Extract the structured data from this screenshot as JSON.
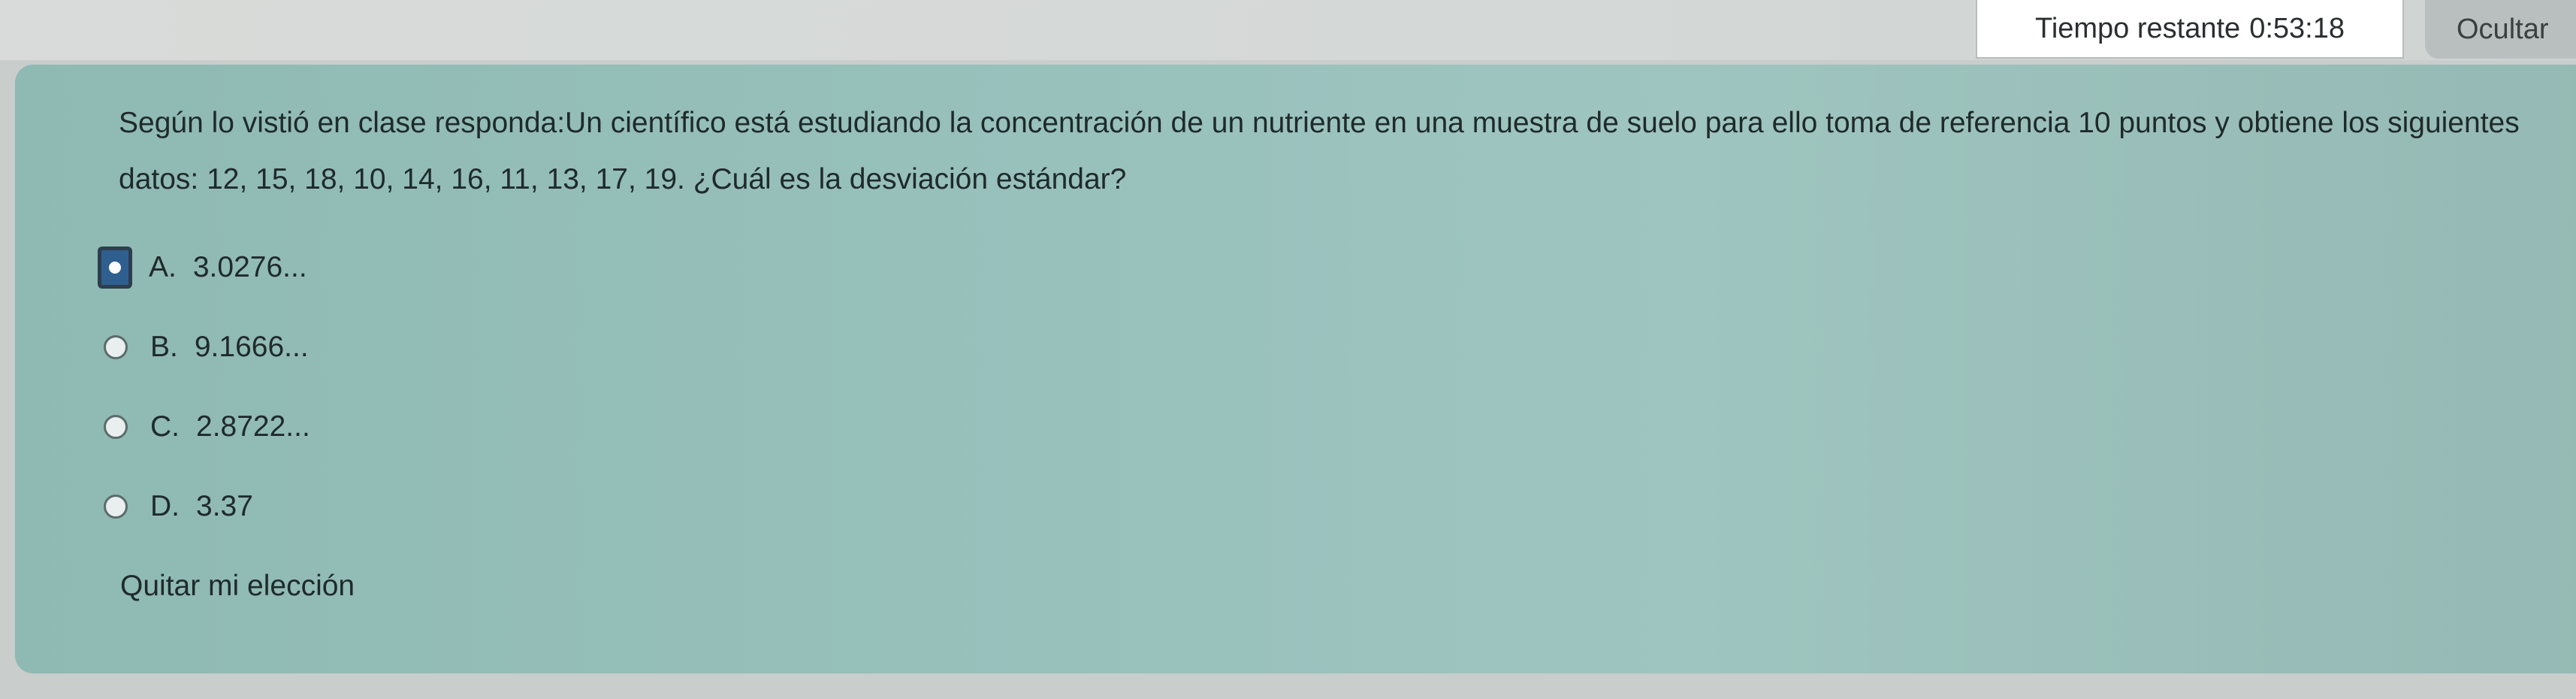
{
  "header": {
    "timer_label": "Tiempo restante",
    "timer_value": "0:53:18",
    "hide_label": "Ocultar"
  },
  "question": {
    "text": "Según lo vistió en clase responda:Un científico está estudiando la concentración de un nutriente en una muestra de suelo para ello toma de referencia 10 puntos y obtiene los siguientes datos: 12, 15, 18, 10, 14, 16, 11, 13, 17, 19. ¿Cuál es la desviación estándar?",
    "options": [
      {
        "letter": "A.",
        "value": "3.0276...",
        "selected": true
      },
      {
        "letter": "B.",
        "value": "9.1666...",
        "selected": false
      },
      {
        "letter": "C.",
        "value": "2.8722...",
        "selected": false
      },
      {
        "letter": "D.",
        "value": "3.37",
        "selected": false
      }
    ],
    "clear_label": "Quitar mi elección"
  }
}
